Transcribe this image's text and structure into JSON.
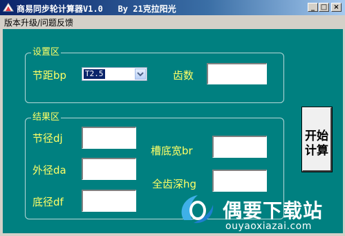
{
  "window": {
    "title": "商易同步轮计算器V1.0   By 21克拉阳光",
    "controls": {
      "minimize": "_",
      "maximize": "□",
      "close": "×"
    }
  },
  "menu": {
    "items": [
      "版本升级/问题反馈"
    ]
  },
  "settings": {
    "title": "设置区",
    "pitch_label": "节距bp",
    "pitch_value": "T2.5",
    "teeth_label": "齿数",
    "teeth_value": ""
  },
  "results": {
    "title": "结果区",
    "pitch_diameter_label": "节径dj",
    "outer_diameter_label": "外径da",
    "root_diameter_label": "底径df",
    "groove_width_label": "槽底宽br",
    "full_tooth_depth_label": "全齿深hg",
    "pitch_diameter_value": "",
    "outer_diameter_value": "",
    "root_diameter_value": "",
    "groove_width_value": "",
    "full_tooth_depth_value": ""
  },
  "start_button": {
    "line1": "开始",
    "line2": "计算"
  },
  "watermark": {
    "brand": "偶要下载站",
    "url": "ouyaoxiazai.com"
  },
  "colors": {
    "client_bg": "#008080",
    "label": "#ffff66",
    "titlebar": "#0a246a"
  },
  "icons": [
    "app-icon",
    "chevron-down-icon",
    "watermark-logo-icon"
  ]
}
